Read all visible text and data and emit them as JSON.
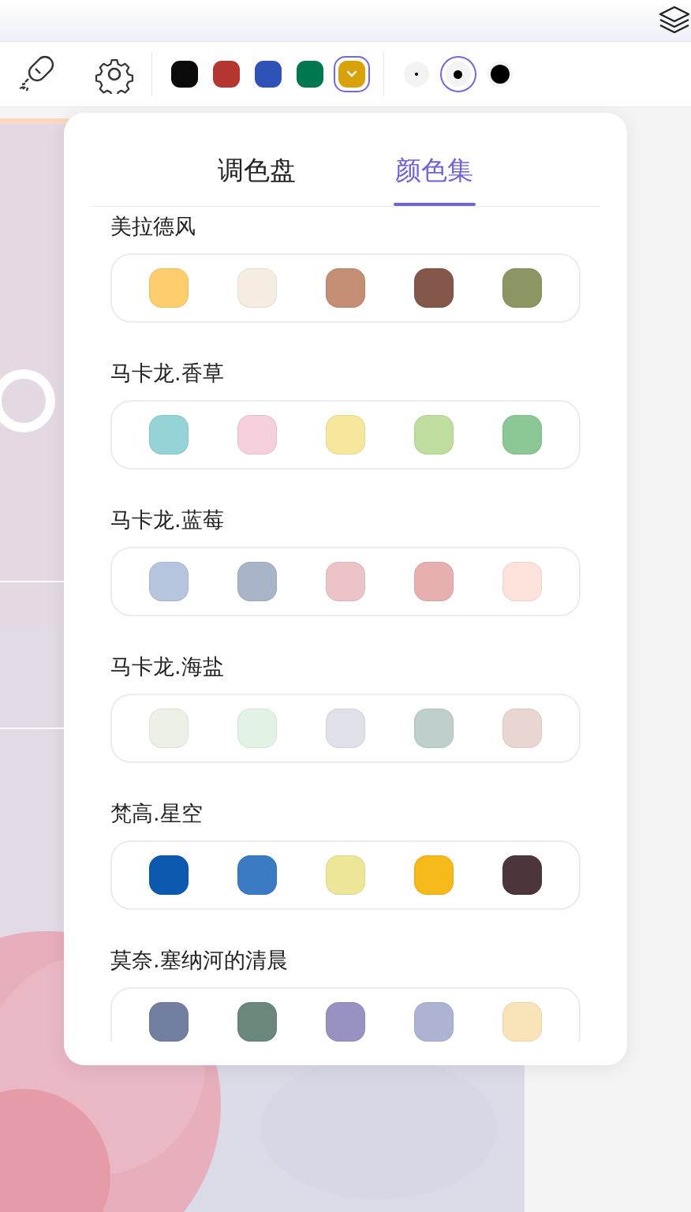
{
  "toolbar": {
    "colors": [
      {
        "color": "#0a0a0a",
        "selected": false
      },
      {
        "color": "#b53531",
        "selected": false
      },
      {
        "color": "#2e52b5",
        "selected": false
      },
      {
        "color": "#00774e",
        "selected": false
      },
      {
        "color": "#d9a20a",
        "selected": true
      }
    ],
    "sizes": [
      {
        "kind": "small",
        "selected": false
      },
      {
        "kind": "medium",
        "selected": true
      },
      {
        "kind": "large",
        "selected": false
      }
    ]
  },
  "popup": {
    "tabs": [
      {
        "label": "调色盘",
        "selected": false
      },
      {
        "label": "颜色集",
        "selected": true
      }
    ],
    "sets": [
      {
        "name": "美拉德风",
        "colors": [
          {
            "color": "#fecd6e"
          },
          {
            "color": "#f5ede1"
          },
          {
            "color": "#c48e75"
          },
          {
            "color": "#84574a"
          },
          {
            "color": "#8b9662"
          }
        ]
      },
      {
        "name": "马卡龙.香草",
        "colors": [
          {
            "color": "#95d3d6"
          },
          {
            "color": "#f5cfdc"
          },
          {
            "color": "#f6e79c"
          },
          {
            "color": "#bedd9e"
          },
          {
            "color": "#8bc795"
          }
        ]
      },
      {
        "name": "马卡龙.蓝莓",
        "colors": [
          {
            "color": "#b6c4de"
          },
          {
            "color": "#a9b4c8"
          },
          {
            "color": "#ecc3c6"
          },
          {
            "color": "#e6b0b1"
          },
          {
            "color": "#fde3dc"
          }
        ]
      },
      {
        "name": "马卡龙.海盐",
        "colors": [
          {
            "color": "#ecf1e8"
          },
          {
            "color": "#e2f3e6"
          },
          {
            "color": "#dee2e8"
          },
          {
            "color": "#bfcfcb"
          },
          {
            "color": "#ead6d0"
          }
        ]
      },
      {
        "name": "梵高.星空",
        "colors": [
          {
            "color": "#0c5ab0"
          },
          {
            "color": "#3a7bc4"
          },
          {
            "color": "#ede597"
          },
          {
            "color": "#f5b91a"
          },
          {
            "color": "#4d363b"
          }
        ]
      },
      {
        "name": "莫奈.塞纳河的清晨",
        "colors": [
          {
            "color": "#737fa0"
          },
          {
            "color": "#6a877c"
          },
          {
            "color": "#9892c2"
          },
          {
            "color": "#adb4d3"
          },
          {
            "color": "#f8e4b8"
          }
        ]
      }
    ]
  }
}
